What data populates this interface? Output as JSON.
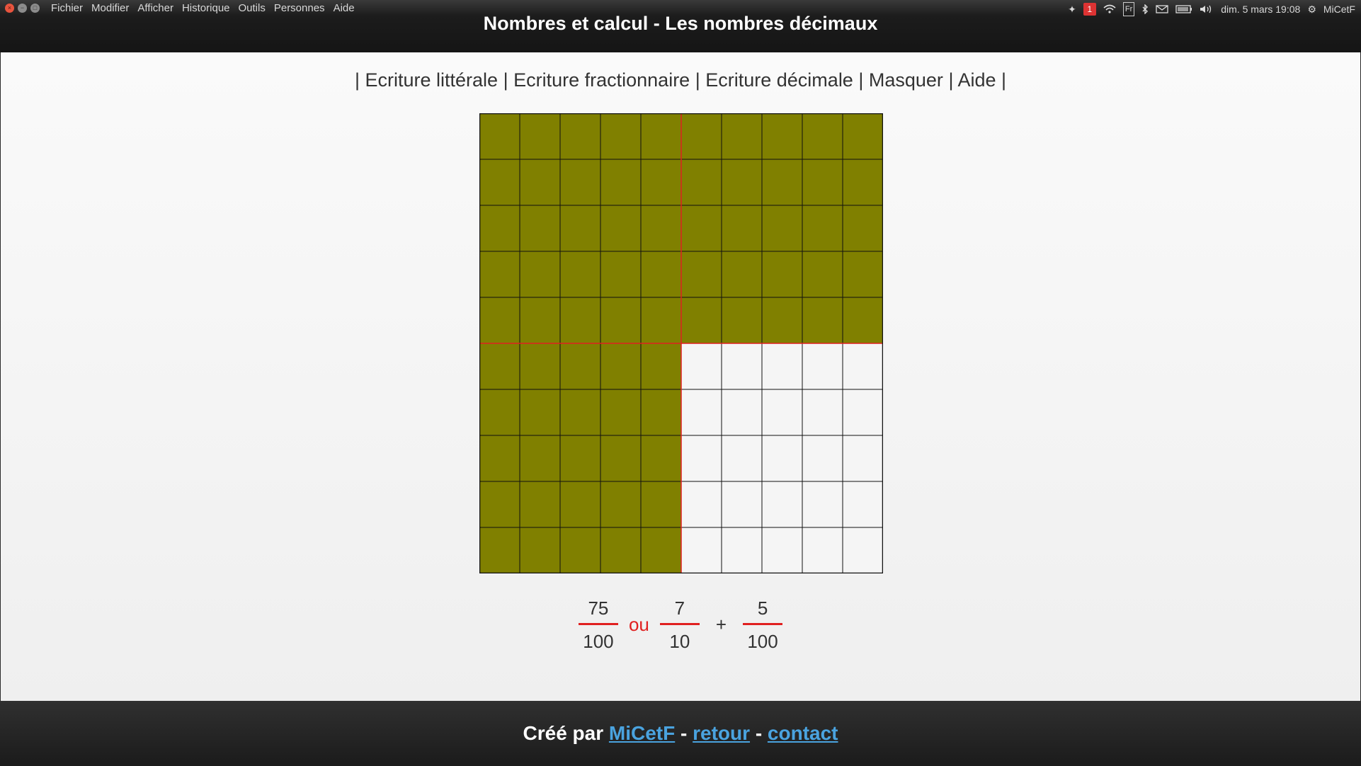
{
  "menubar": {
    "items": [
      "Fichier",
      "Modifier",
      "Afficher",
      "Historique",
      "Outils",
      "Personnes",
      "Aide"
    ]
  },
  "indicators": {
    "notification_count": "1",
    "keyboard_layout": "Fr",
    "datetime": "dim. 5 mars 19:08",
    "user": "MiCetF",
    "icons": [
      "dropbox-icon",
      "notification-icon",
      "wifi-icon",
      "keyboard-icon",
      "bluetooth-icon",
      "mail-icon",
      "battery-icon",
      "volume-icon",
      "gear-icon"
    ]
  },
  "page": {
    "title": "Nombres et calcul - Les nombres décimaux"
  },
  "nav": {
    "separator": "|",
    "links": [
      "Ecriture littérale",
      "Ecriture fractionnaire",
      "Ecriture décimale",
      "Masquer",
      "Aide"
    ]
  },
  "grid": {
    "rows": 10,
    "cols": 10,
    "shaded_count": 75,
    "shaded_tenths": 7,
    "shaded_hundredths": 5,
    "fill_color": "#808000",
    "empty_color": "#f5f5f5",
    "line_color": "#111111",
    "highlight_color": "#e02020"
  },
  "fractions": {
    "first": {
      "numerator": "75",
      "denominator": "100"
    },
    "connector": "ou",
    "second": {
      "numerator": "7",
      "denominator": "10"
    },
    "operator": "+",
    "third": {
      "numerator": "5",
      "denominator": "100"
    }
  },
  "footer": {
    "prefix": "Créé par",
    "author_link": "MiCetF",
    "dash": "-",
    "back_link": "retour",
    "contact_link": "contact"
  },
  "colors": {
    "link": "#4aa3df",
    "accent_red": "#e02020"
  }
}
